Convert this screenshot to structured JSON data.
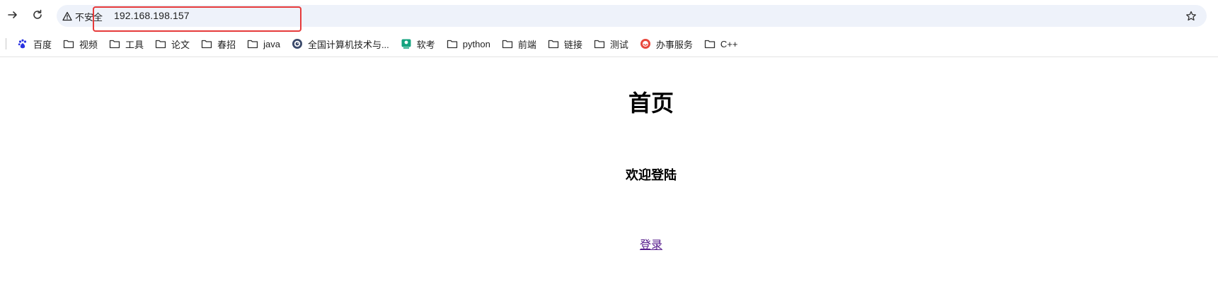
{
  "toolbar": {
    "security_label": "不安全",
    "url": "192.168.198.157"
  },
  "bookmarks": [
    {
      "label": "百度",
      "icon": "baidu-icon"
    },
    {
      "label": "视频",
      "icon": "folder-icon"
    },
    {
      "label": "工具",
      "icon": "folder-icon"
    },
    {
      "label": "论文",
      "icon": "folder-icon"
    },
    {
      "label": "春招",
      "icon": "folder-icon"
    },
    {
      "label": "java",
      "icon": "folder-icon"
    },
    {
      "label": "全国计算机技术与...",
      "icon": "eye-logo-icon"
    },
    {
      "label": "软考",
      "icon": "ruankao-icon"
    },
    {
      "label": "python",
      "icon": "folder-icon"
    },
    {
      "label": "前端",
      "icon": "folder-icon"
    },
    {
      "label": "链接",
      "icon": "folder-icon"
    },
    {
      "label": "测试",
      "icon": "folder-icon"
    },
    {
      "label": "办事服务",
      "icon": "service-icon"
    },
    {
      "label": "C++",
      "icon": "folder-icon"
    }
  ],
  "page": {
    "title": "首页",
    "welcome": "欢迎登陆",
    "login_link": "登录"
  },
  "colors": {
    "omnibox_bg": "#eef2fa",
    "highlight_border": "#e63a3a",
    "visited_link": "#551a8b"
  }
}
